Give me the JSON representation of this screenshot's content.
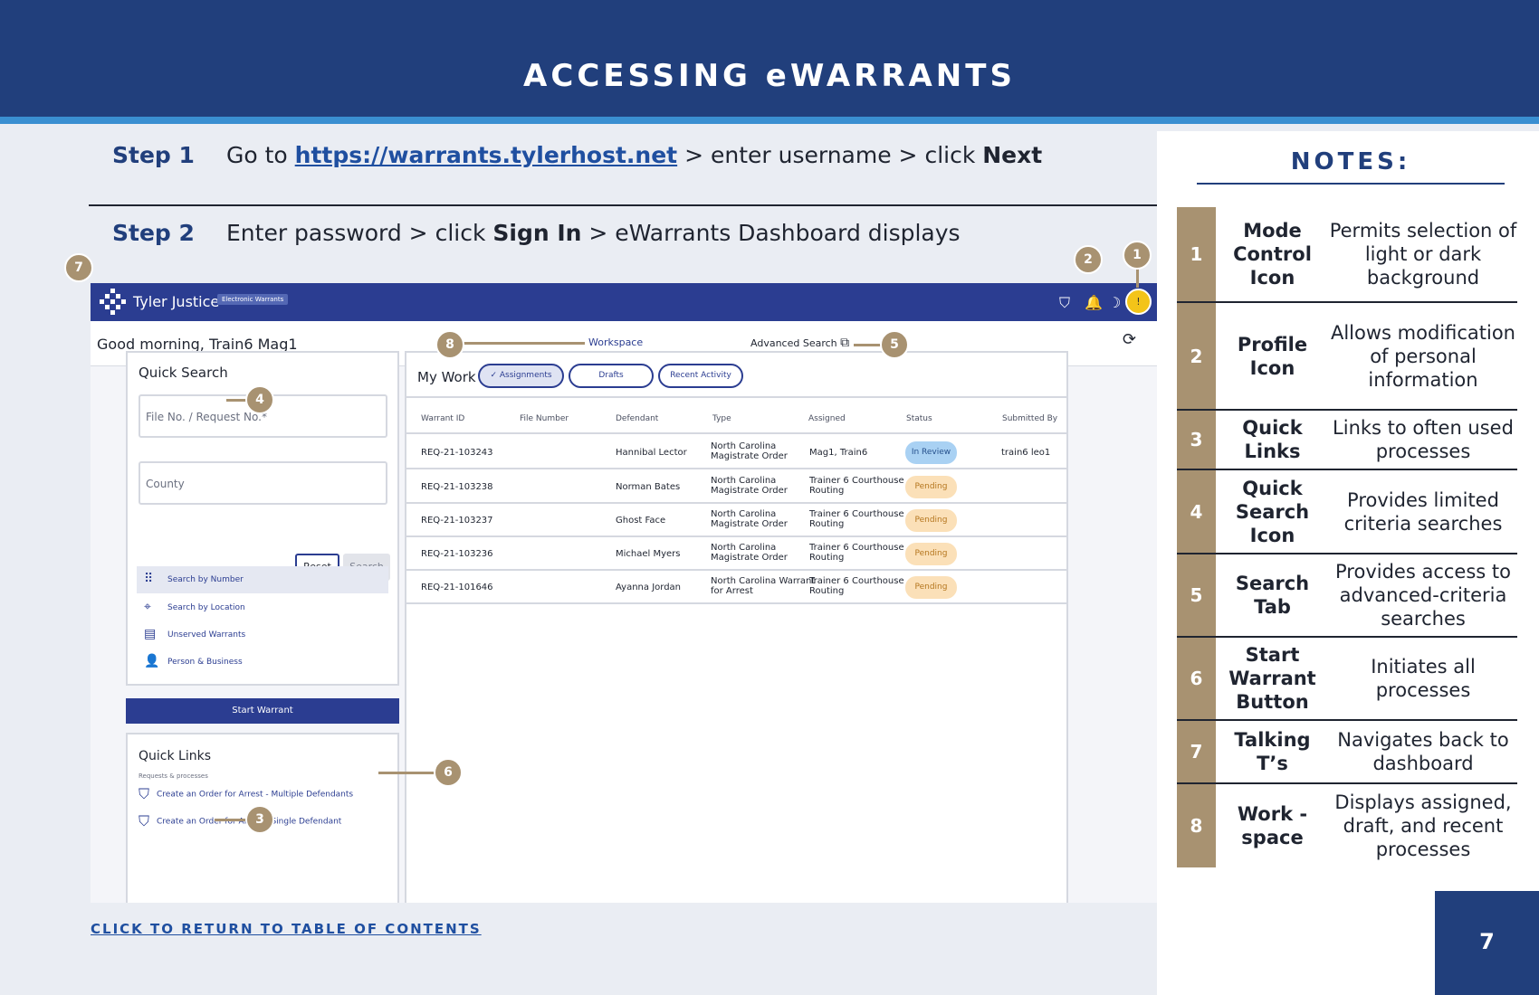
{
  "header": {
    "title": "ACCESSING eWARRANTS"
  },
  "steps": [
    {
      "label": "Step 1",
      "pre": "Go to ",
      "link": "https://warrants.tylerhost.net",
      "mid": " > enter username > click ",
      "bold": "Next",
      "post": ""
    },
    {
      "label": "Step 2",
      "pre": "Enter password > click ",
      "bold": "Sign In",
      "post": " > eWarrants Dashboard displays"
    }
  ],
  "app": {
    "brand": "Tyler Justice",
    "badge": "Electronic Warrants",
    "greeting": "Good morning, Train6 Mag1",
    "tabs": {
      "workspace": "Workspace",
      "advanced": "Advanced Search"
    },
    "quick_search": {
      "title": "Quick Search",
      "file_placeholder": "File No. / Request No.*",
      "county_placeholder": "County",
      "reset": "Reset",
      "search": "Search",
      "items": [
        {
          "label": "Search by Number",
          "icon": "keypad-icon"
        },
        {
          "label": "Search by Location",
          "icon": "crosshair-icon"
        },
        {
          "label": "Unserved Warrants",
          "icon": "archive-icon"
        },
        {
          "label": "Person & Business",
          "icon": "person-icon"
        }
      ]
    },
    "start_warrant": "Start Warrant",
    "quick_links": {
      "title": "Quick Links",
      "subtitle": "Requests & processes",
      "links": [
        "Create an Order for Arrest - Multiple Defendants",
        "Create an Order for Arrest - Single Defendant"
      ]
    },
    "my_work": {
      "title": "My Work",
      "filters": [
        "Assignments",
        "Drafts",
        "Recent Activity"
      ],
      "columns": [
        "Warrant ID",
        "File Number",
        "Defendant",
        "Type",
        "Assigned",
        "Status",
        "Submitted By"
      ],
      "rows": [
        {
          "id": "REQ-21-103243",
          "file": "",
          "defendant": "Hannibal Lector",
          "type1": "North Carolina",
          "type2": "Magistrate Order",
          "assigned1": "Mag1, Train6",
          "assigned2": "",
          "status": "In Review",
          "submitted": "train6 leo1"
        },
        {
          "id": "REQ-21-103238",
          "file": "",
          "defendant": "Norman Bates",
          "type1": "North Carolina",
          "type2": "Magistrate Order",
          "assigned1": "Trainer 6 Courthouse",
          "assigned2": "Routing",
          "status": "Pending",
          "submitted": ""
        },
        {
          "id": "REQ-21-103237",
          "file": "",
          "defendant": "Ghost Face",
          "type1": "North Carolina",
          "type2": "Magistrate Order",
          "assigned1": "Trainer 6 Courthouse",
          "assigned2": "Routing",
          "status": "Pending",
          "submitted": ""
        },
        {
          "id": "REQ-21-103236",
          "file": "",
          "defendant": "Michael Myers",
          "type1": "North Carolina",
          "type2": "Magistrate Order",
          "assigned1": "Trainer 6 Courthouse",
          "assigned2": "Routing",
          "status": "Pending",
          "submitted": ""
        },
        {
          "id": "REQ-21-101646",
          "file": "",
          "defendant": "Ayanna Jordan",
          "type1": "North Carolina Warrant",
          "type2": "for Arrest",
          "assigned1": "Trainer 6 Courthouse",
          "assigned2": "Routing",
          "status": "Pending",
          "submitted": ""
        }
      ]
    }
  },
  "callouts": [
    "1",
    "2",
    "3",
    "4",
    "5",
    "6",
    "7",
    "8"
  ],
  "toc_link": "CLICK TO RETURN TO TABLE OF CONTENTS",
  "notes": {
    "title": "NOTES:",
    "items": [
      {
        "num": "1",
        "term": "Mode Control Icon",
        "desc": "Permits selection of light or dark background"
      },
      {
        "num": "2",
        "term": "Profile Icon",
        "desc": "Allows modification of personal information"
      },
      {
        "num": "3",
        "term": "Quick Links",
        "desc": "Links to often used processes"
      },
      {
        "num": "4",
        "term": "Quick Search Icon",
        "desc": "Provides limited criteria searches"
      },
      {
        "num": "5",
        "term": "Search Tab",
        "desc": "Provides access to advanced-criteria searches"
      },
      {
        "num": "6",
        "term": "Start Warrant Button",
        "desc": "Initiates all processes"
      },
      {
        "num": "7",
        "term": "Talking T’s",
        "desc": "Navigates back to dashboard"
      },
      {
        "num": "8",
        "term": "Work -space",
        "desc": "Displays assigned, draft, and recent processes"
      }
    ]
  },
  "page_number": "7",
  "colors": {
    "navy": "#213f7c",
    "app_blue": "#2b3d91",
    "accent_tan": "#a89271",
    "link_blue": "#1f4fa0"
  }
}
